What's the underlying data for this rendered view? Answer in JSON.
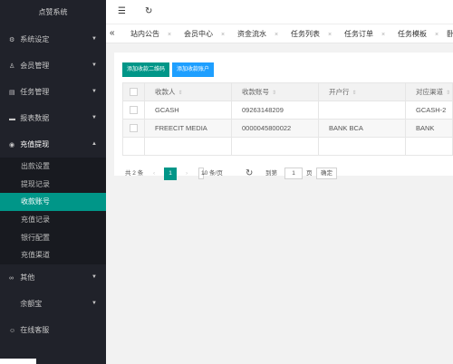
{
  "app": {
    "title": "点赞系统"
  },
  "sidebar": {
    "items": [
      {
        "label": "系统设定",
        "icon": "gear-icon",
        "glyph": "⚙"
      },
      {
        "label": "会员管理",
        "icon": "user-icon",
        "glyph": "♙"
      },
      {
        "label": "任务管理",
        "icon": "task-icon",
        "glyph": "▤"
      },
      {
        "label": "报表数据",
        "icon": "chart-icon",
        "glyph": "▬"
      },
      {
        "label": "充值提现",
        "icon": "money-icon",
        "glyph": "◉"
      }
    ],
    "sub_items": [
      "出款设置",
      "提现记录",
      "收款账号",
      "充值记录",
      "银行配置",
      "充值渠道"
    ],
    "bottom_items": [
      {
        "label": "其他",
        "icon": "link-icon",
        "glyph": "∞"
      },
      {
        "label": "余额宝",
        "icon": "",
        "glyph": ""
      },
      {
        "label": "在线客服",
        "icon": "support-icon",
        "glyph": "☺"
      }
    ]
  },
  "header": {
    "menu_glyph": "☰",
    "refresh_glyph": "↻"
  },
  "tabs": {
    "arrow": "«",
    "items": [
      "站内公告",
      "会员中心",
      "资金流水",
      "任务列表",
      "任务订单",
      "任务模板"
    ],
    "close": "×",
    "overflow": "卧"
  },
  "toolbar": {
    "add_qrcode": "添加收款二维码",
    "add_account": "添加收款账户"
  },
  "table": {
    "columns": [
      "收款人",
      "收款账号",
      "开户行",
      "对应渠道"
    ],
    "rows": [
      [
        "GCASH",
        "09263148209",
        "",
        "GCASH-2"
      ],
      [
        "FREECIT MEDIA",
        "0000045800022",
        "BANK BCA",
        "BANK"
      ]
    ]
  },
  "pager": {
    "total": "共 2 条",
    "prev": "‹",
    "current": "1",
    "next": "›",
    "per_page": "10 条/页",
    "goto": "到第",
    "page_input": "1",
    "page_unit": "页",
    "confirm": "确定"
  }
}
